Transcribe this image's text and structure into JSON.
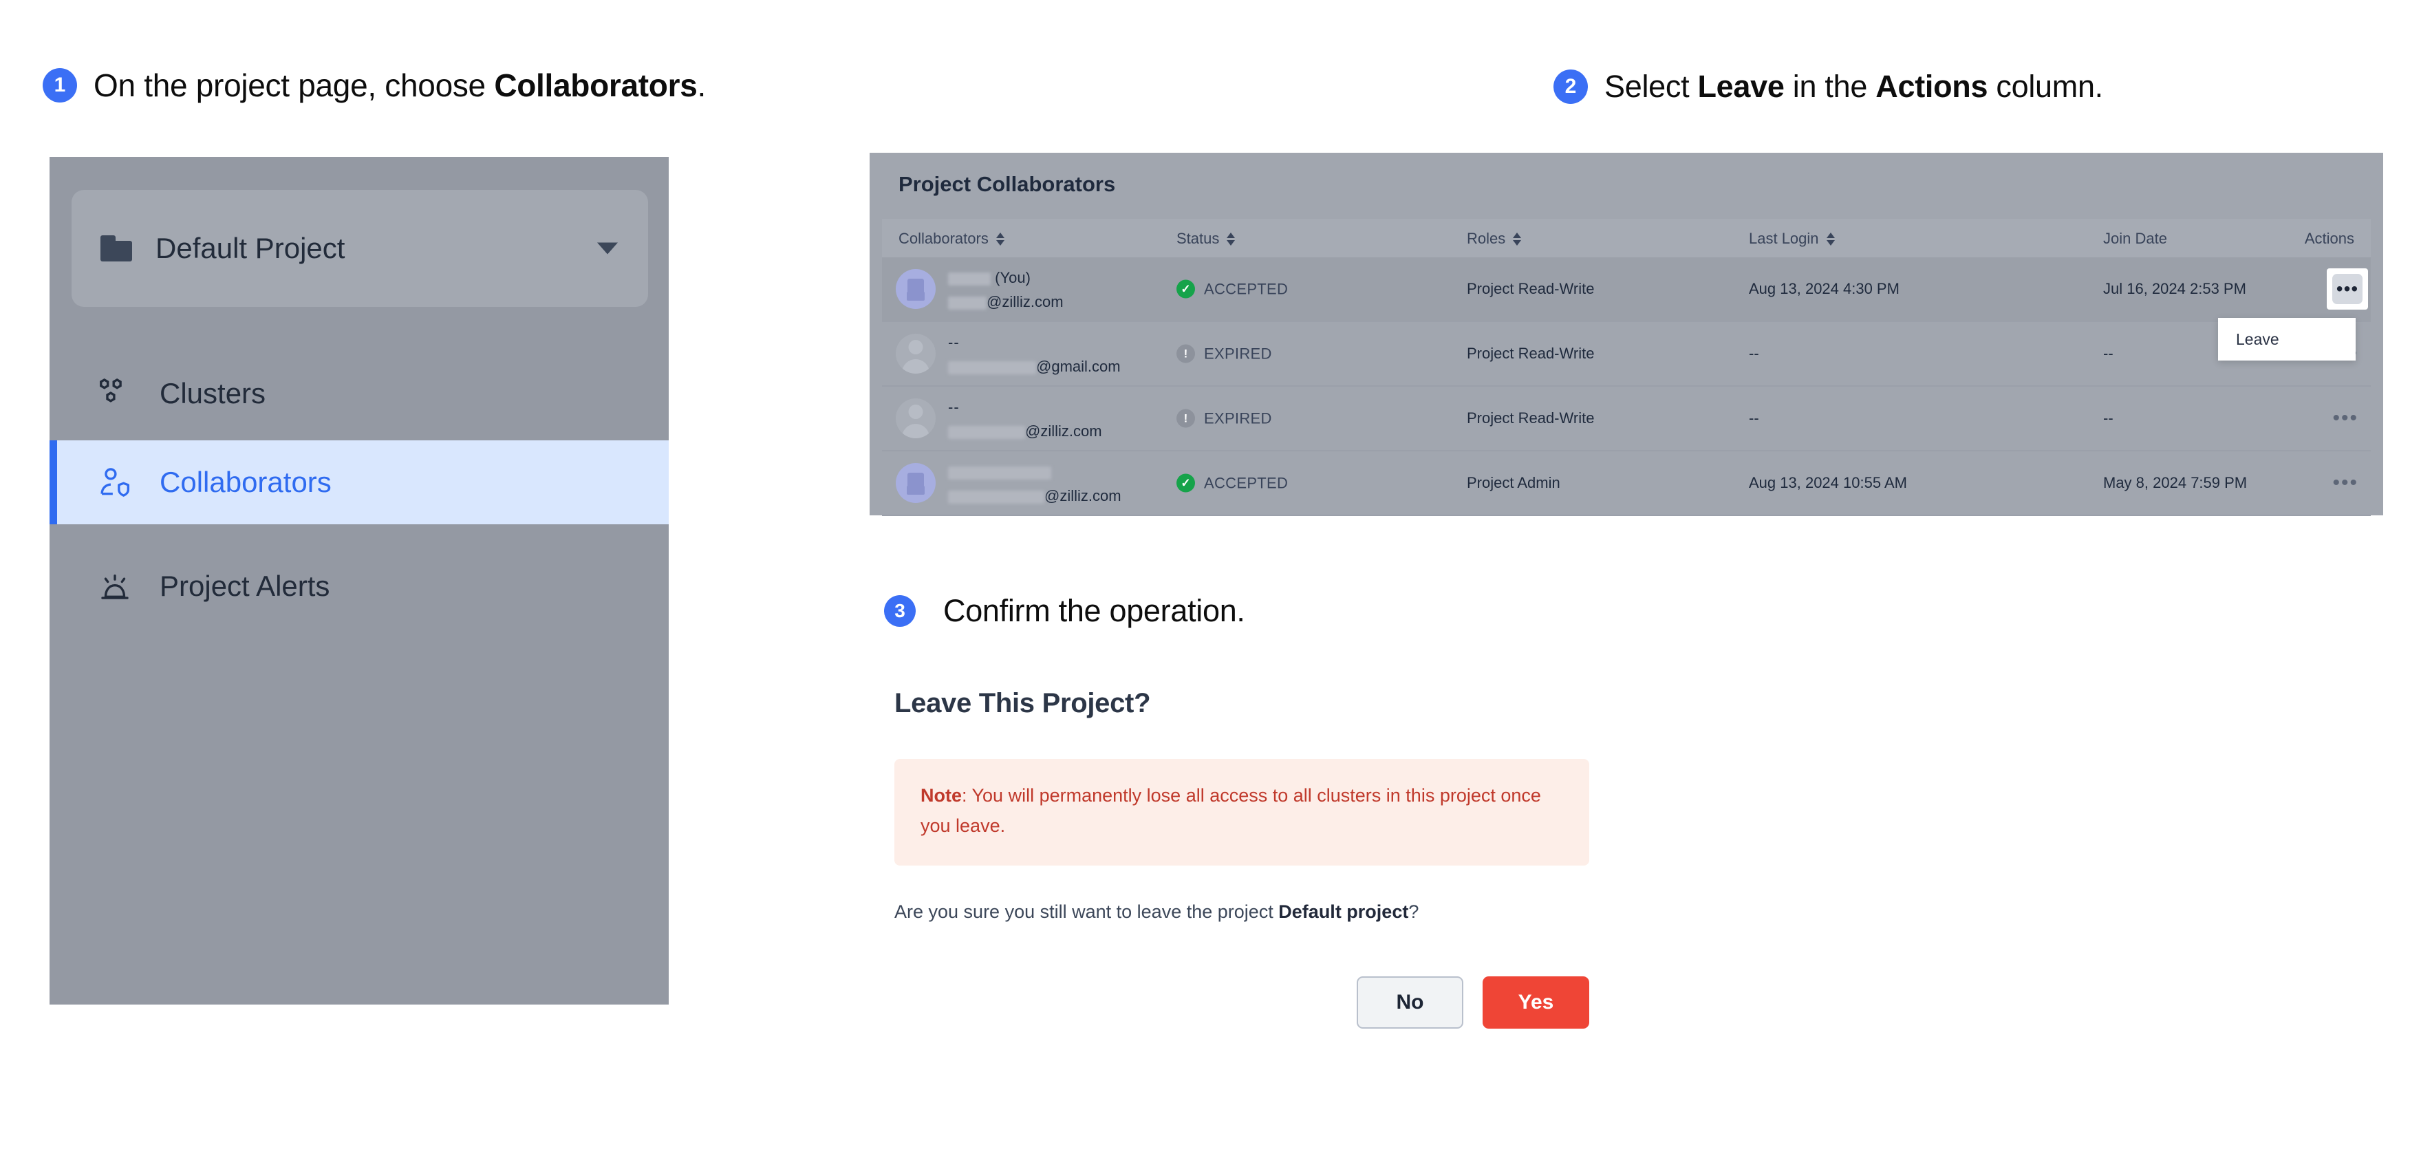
{
  "steps": [
    {
      "number": "1",
      "prefix": "On the project page, choose ",
      "strong": "Collaborators",
      "suffix": "."
    },
    {
      "number": "2",
      "prefix": "Select ",
      "strong": "Leave",
      "mid": " in the ",
      "strong2": "Actions",
      "suffix": " column."
    },
    {
      "number": "3",
      "text": "Confirm the operation."
    }
  ],
  "sidebar": {
    "project_selector": {
      "label": "Default Project",
      "icon": "folder-icon",
      "caret": "chevron-down-icon"
    },
    "items": [
      {
        "label": "Clusters",
        "icon": "clusters-icon",
        "active": false
      },
      {
        "label": "Collaborators",
        "icon": "collaborators-icon",
        "active": true
      },
      {
        "label": "Project Alerts",
        "icon": "alert-beacon-icon",
        "active": false
      }
    ]
  },
  "table": {
    "title": "Project Collaborators",
    "columns": [
      {
        "label": "Collaborators",
        "sortable": true
      },
      {
        "label": "Status",
        "sortable": true
      },
      {
        "label": "Roles",
        "sortable": true
      },
      {
        "label": "Last Login",
        "sortable": true
      },
      {
        "label": "Join Date",
        "sortable": false
      },
      {
        "label": "Actions",
        "sortable": false
      }
    ],
    "rows": [
      {
        "name_suffix": "(You)",
        "email_suffix": "@zilliz.com",
        "status": "ACCEPTED",
        "status_type": "accepted",
        "role": "Project Read-Write",
        "last_login": "Aug 13, 2024 4:30 PM",
        "join_date": "Jul 16, 2024 2:53 PM",
        "action_icon": "more-options-icon",
        "action_active": true,
        "avatar_type": "logo"
      },
      {
        "name_suffix": "--",
        "email_suffix": "@gmail.com",
        "status": "EXPIRED",
        "status_type": "expired",
        "role": "Project Read-Write",
        "last_login": "--",
        "join_date": "--",
        "action_icon": "more-options-icon",
        "action_active": false,
        "avatar_type": "person"
      },
      {
        "name_suffix": "--",
        "email_suffix": "@zilliz.com",
        "status": "EXPIRED",
        "status_type": "expired",
        "role": "Project Read-Write",
        "last_login": "--",
        "join_date": "--",
        "action_icon": "more-options-icon",
        "action_active": false,
        "avatar_type": "person"
      },
      {
        "name_suffix": "",
        "email_suffix": "@zilliz.com",
        "status": "ACCEPTED",
        "status_type": "accepted",
        "role": "Project Admin",
        "last_login": "Aug 13, 2024 10:55 AM",
        "join_date": "May 8, 2024 7:59 PM",
        "action_icon": "more-options-icon",
        "action_active": false,
        "avatar_type": "logo"
      }
    ],
    "dropdown": {
      "items": [
        "Leave"
      ]
    }
  },
  "dialog": {
    "title": "Leave This Project?",
    "note_label": "Note",
    "note_text": ": You will permanently lose all access to all clusters in this project once you leave.",
    "confirm_prefix": "Are you sure you still want to leave the project ",
    "confirm_project": "Default project",
    "confirm_suffix": "?",
    "no_label": "No",
    "yes_label": "Yes"
  },
  "colors": {
    "accent_blue": "#3b6ff5",
    "nav_active_bg": "#d9e7fe",
    "nav_active_text": "#2f6bf0",
    "status_accepted": "#16a34a",
    "status_expired": "#8d929c",
    "note_bg": "#fdeee8",
    "note_text": "#c0392b",
    "danger": "#ef4536"
  }
}
